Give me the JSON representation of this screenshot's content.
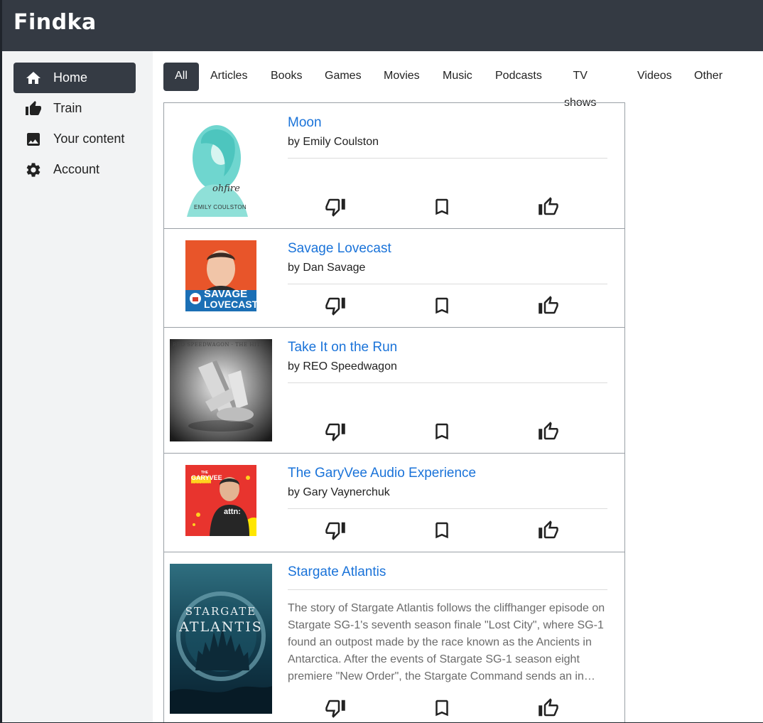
{
  "app": {
    "title": "Findka"
  },
  "sidebar": {
    "items": [
      {
        "label": "Home",
        "icon": "home-icon",
        "active": true
      },
      {
        "label": "Train",
        "icon": "thumb-up-icon"
      },
      {
        "label": "Your content",
        "icon": "image-icon"
      },
      {
        "label": "Account",
        "icon": "gear-icon"
      }
    ]
  },
  "tabs": [
    {
      "label": "All",
      "active": true
    },
    {
      "label": "Articles"
    },
    {
      "label": "Books"
    },
    {
      "label": "Games"
    },
    {
      "label": "Movies"
    },
    {
      "label": "Music"
    },
    {
      "label": "Podcasts"
    },
    {
      "label": "TV shows"
    },
    {
      "label": "Videos"
    },
    {
      "label": "Other"
    }
  ],
  "feed": {
    "items": [
      {
        "title": "Moon",
        "author": "by Emily Coulston",
        "cover_text": [
          "ohfire",
          "EMILY COULSTON"
        ]
      },
      {
        "title": "Savage Lovecast",
        "author": "by Dan Savage",
        "cover_text": [
          "SAVAGE",
          "LOVECAST"
        ]
      },
      {
        "title": "Take It on the Run",
        "author": "by REO Speedwagon",
        "cover_text": [
          "REO SPEEDWAGON · THE HITS"
        ]
      },
      {
        "title": "The GaryVee Audio Experience",
        "author": "by Gary Vaynerchuk",
        "cover_text": [
          "THE",
          "GARYVEE",
          "AUDIO EXPERIENCE",
          "attn:"
        ]
      },
      {
        "title": "Stargate Atlantis",
        "author": "",
        "description": "The story of Stargate Atlantis follows the cliffhanger episode on Stargate SG-1's seventh season finale \"Lost City\", where SG-1 found an outpost made by the race known as the Ancients in Antarctica. After the events of Stargate SG-1 season eight premiere \"New Order\", the Stargate Command sends an in…",
        "cover_text": [
          "STARGATE",
          "ATLANTIS"
        ]
      }
    ]
  },
  "colors": {
    "header": "#343a43",
    "accent": "#1a73d9",
    "sidebar": "#f2f3f4"
  }
}
